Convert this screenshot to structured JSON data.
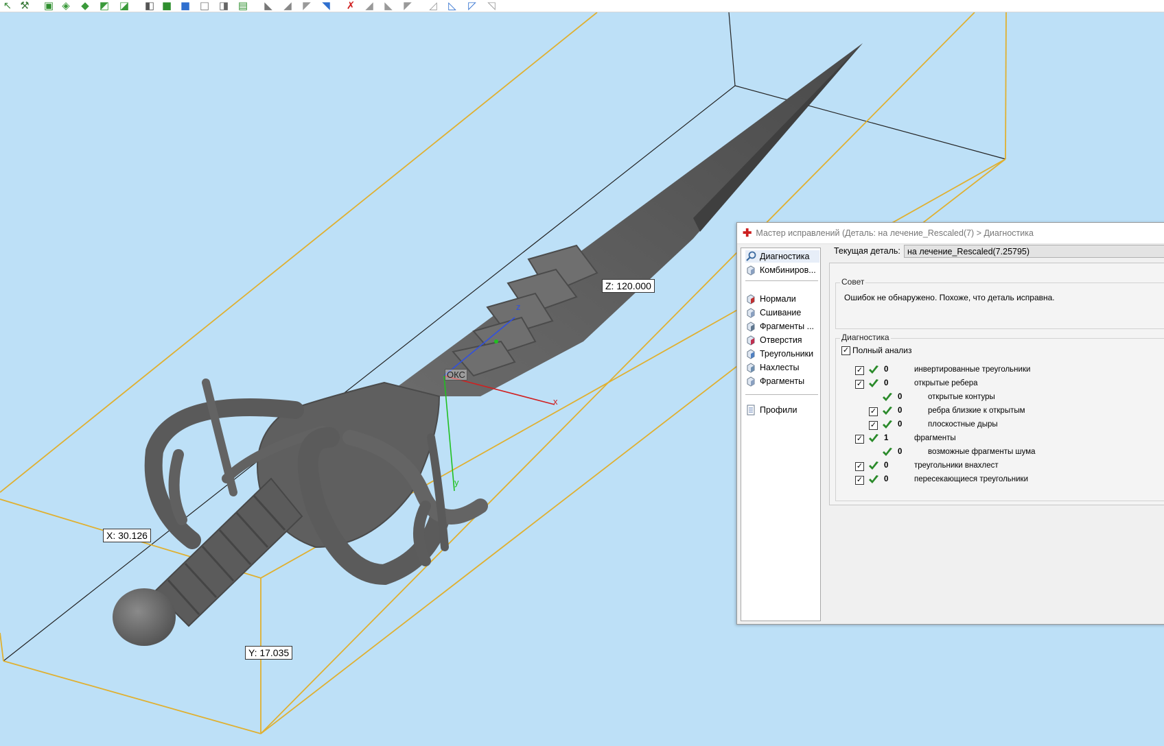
{
  "toolbar": {
    "buttons": [
      {
        "icon": "select-icon",
        "glyph": "↖"
      },
      {
        "icon": "wand-icon",
        "glyph": "⚒"
      },
      {
        "icon": "mark-surface-icon",
        "glyph": "▣"
      },
      {
        "icon": "mark-shell-icon",
        "glyph": "◈"
      },
      {
        "icon": "mark-plane-icon",
        "glyph": "◆"
      },
      {
        "icon": "mark-triangle-icon",
        "glyph": "◩"
      },
      {
        "icon": "mark-expand-icon",
        "glyph": "◪"
      },
      {
        "icon": "part-new-icon",
        "glyph": "◧"
      },
      {
        "icon": "part-green-icon",
        "glyph": "■"
      },
      {
        "icon": "part-blue-icon",
        "glyph": "■"
      },
      {
        "icon": "part-white-icon",
        "glyph": "□"
      },
      {
        "icon": "part-grey-icon",
        "glyph": "◨"
      },
      {
        "icon": "part-stack-icon",
        "glyph": "▤"
      },
      {
        "icon": "triangle-select-icon",
        "glyph": "◣"
      },
      {
        "icon": "triangle-grey-icon",
        "glyph": "◢"
      },
      {
        "icon": "triangle-white-icon",
        "glyph": "◤"
      },
      {
        "icon": "triangle-blue-icon",
        "glyph": "◥"
      },
      {
        "icon": "delete-triangles-icon",
        "glyph": "✗"
      },
      {
        "icon": "triangle-grey2-icon",
        "glyph": "◢"
      },
      {
        "icon": "triangle-grey3-icon",
        "glyph": "◣"
      },
      {
        "icon": "triangle-grey4-icon",
        "glyph": "◤"
      },
      {
        "icon": "edge-icon",
        "glyph": "◿"
      },
      {
        "icon": "edge-blue-icon",
        "glyph": "◺"
      },
      {
        "icon": "edge-blue2-icon",
        "glyph": "◸"
      },
      {
        "icon": "edge-grey-icon",
        "glyph": "◹"
      }
    ]
  },
  "viewport": {
    "dimension_x": "X: 30.126",
    "dimension_y": "Y: 17.035",
    "dimension_z": "Z: 120.000",
    "axis_x": "x",
    "axis_y": "y",
    "axis_z": "z",
    "origin_label": "ОКС",
    "colors": {
      "background": "#bde0f7",
      "bbox": "#e0b030",
      "model": "#5f5f5f"
    }
  },
  "dialog": {
    "title": "Мастер исправлений (Деталь: на лечение_Rescaled(7) > Диагностика",
    "nav": {
      "items": [
        {
          "label": "Диагностика",
          "icon": "magnifier-icon",
          "active": true
        },
        {
          "label": "Комбиниров...",
          "icon": "combine-icon"
        },
        {
          "label": "Нормали",
          "icon": "normals-icon"
        },
        {
          "label": "Сшивание",
          "icon": "stitch-icon"
        },
        {
          "label": "Фрагменты ...",
          "icon": "fragments-gear-icon"
        },
        {
          "label": "Отверстия",
          "icon": "holes-icon"
        },
        {
          "label": "Треугольники",
          "icon": "triangles-icon"
        },
        {
          "label": "Нахлесты",
          "icon": "overlaps-icon"
        },
        {
          "label": "Фрагменты",
          "icon": "fragments-icon"
        },
        {
          "label": "Профили",
          "icon": "profiles-icon"
        }
      ]
    },
    "current_part_label": "Текущая деталь:",
    "current_part_value": "на лечение_Rescaled(7.25795)",
    "advice": {
      "title": "Совет",
      "text": "Ошибок не обнаружено. Похоже, что деталь исправна."
    },
    "diagnostics": {
      "title": "Диагностика",
      "full_analysis_label": "Полный анализ",
      "full_analysis_checked": true,
      "rows": [
        {
          "count": "0",
          "label": "инвертированные треугольники",
          "indent": 0,
          "checkbox": true
        },
        {
          "count": "0",
          "label": "открытые ребера",
          "indent": 0,
          "checkbox": true
        },
        {
          "count": "0",
          "label": "открытые контуры",
          "indent": 1,
          "checkbox": false
        },
        {
          "count": "0",
          "label": "ребра близкие к открытым",
          "indent": 1,
          "checkbox": true
        },
        {
          "count": "0",
          "label": "плоскостные дыры",
          "indent": 1,
          "checkbox": true
        },
        {
          "count": "1",
          "label": "фрагменты",
          "indent": 0,
          "checkbox": true
        },
        {
          "count": "0",
          "label": "возможные фрагменты шума",
          "indent": 1,
          "checkbox": false
        },
        {
          "count": "0",
          "label": "треугольники внахлест",
          "indent": 0,
          "checkbox": true
        },
        {
          "count": "0",
          "label": "пересекающиеся треугольники",
          "indent": 0,
          "checkbox": true
        }
      ]
    }
  }
}
